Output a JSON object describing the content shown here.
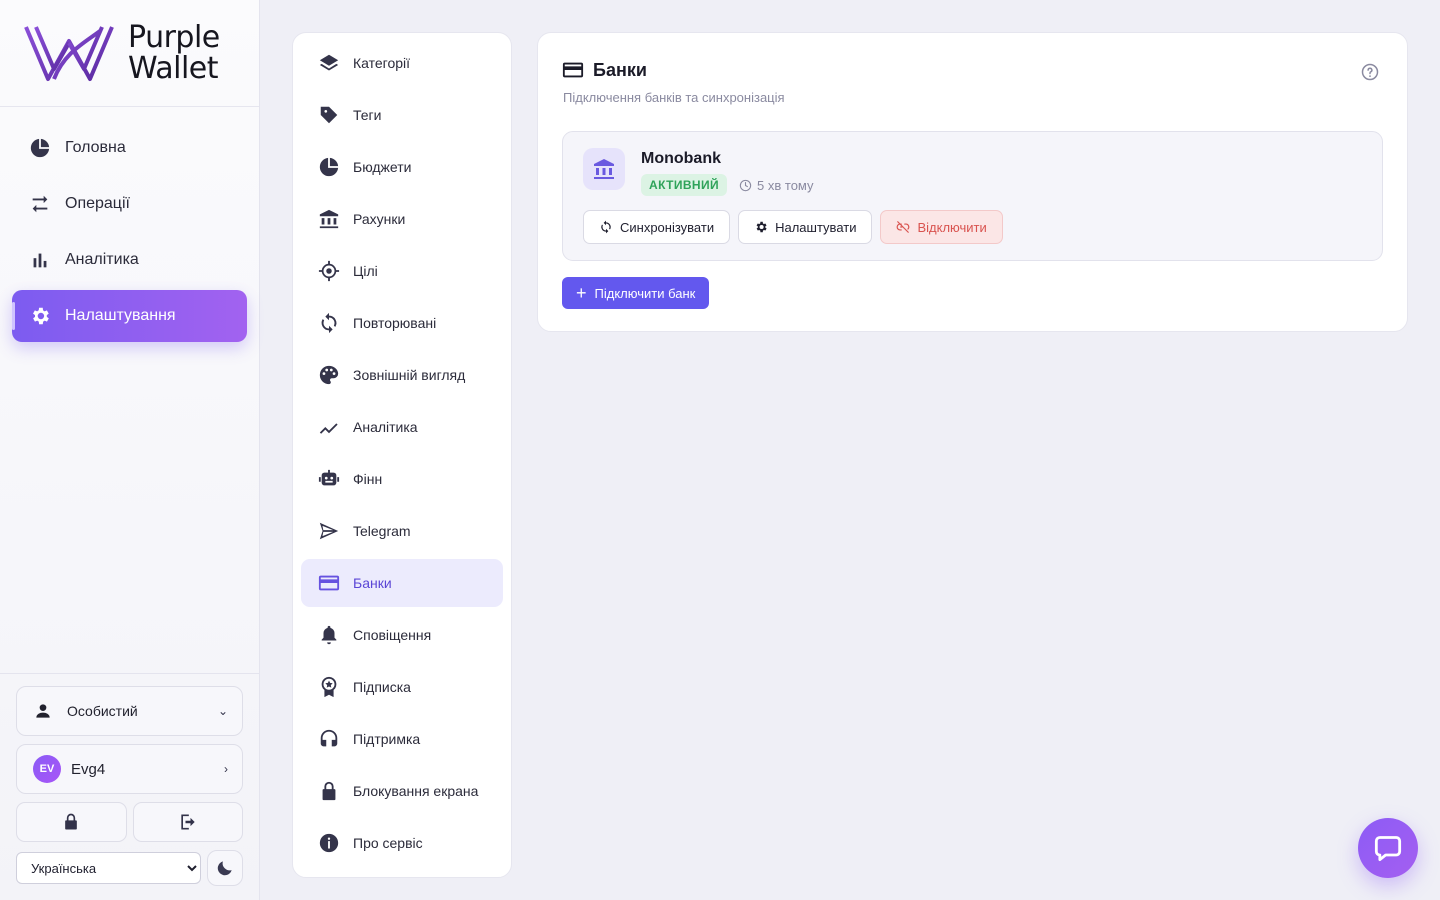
{
  "brand": {
    "line1": "Purple",
    "line2": "Wallet"
  },
  "nav": [
    {
      "label": "Головна",
      "icon": "pie-chart-icon",
      "active": false
    },
    {
      "label": "Операції",
      "icon": "swap-arrows-icon",
      "active": false
    },
    {
      "label": "Аналітика",
      "icon": "bar-chart-icon",
      "active": false
    },
    {
      "label": "Налаштування",
      "icon": "gear-icon",
      "active": true
    }
  ],
  "account": {
    "profile_label": "Особистий",
    "user_initials": "EV",
    "user_name": "Evg4"
  },
  "language": {
    "selected": "Українська"
  },
  "submenu": [
    {
      "label": "Категорії",
      "icon": "layers-icon"
    },
    {
      "label": "Теги",
      "icon": "tag-icon"
    },
    {
      "label": "Бюджети",
      "icon": "pie-chart-icon"
    },
    {
      "label": "Рахунки",
      "icon": "bank-icon"
    },
    {
      "label": "Цілі",
      "icon": "target-icon"
    },
    {
      "label": "Повторювані",
      "icon": "repeat-icon"
    },
    {
      "label": "Зовнішній вигляд",
      "icon": "palette-icon"
    },
    {
      "label": "Аналітика",
      "icon": "trend-line-icon"
    },
    {
      "label": "Фінн",
      "icon": "robot-icon"
    },
    {
      "label": "Telegram",
      "icon": "paper-plane-icon"
    },
    {
      "label": "Банки",
      "icon": "credit-card-icon",
      "active": true
    },
    {
      "label": "Сповіщення",
      "icon": "bell-icon"
    },
    {
      "label": "Підписка",
      "icon": "award-icon"
    },
    {
      "label": "Підтримка",
      "icon": "headset-icon"
    },
    {
      "label": "Блокування екрана",
      "icon": "lock-icon"
    },
    {
      "label": "Про сервіс",
      "icon": "info-icon"
    }
  ],
  "panel": {
    "title": "Банки",
    "subtitle": "Підключення банків та синхронізація",
    "bank": {
      "name": "Monobank",
      "status": "АКТИВНИЙ",
      "last_sync": "5 хв тому",
      "sync_label": "Синхронізувати",
      "settings_label": "Налаштувати",
      "disconnect_label": "Відключити"
    },
    "connect_label": "Підключити банк"
  },
  "colors": {
    "accent": "#7c5cf0",
    "primary_button": "#6358ee",
    "success": "#2fa35a",
    "danger": "#d9534f"
  }
}
